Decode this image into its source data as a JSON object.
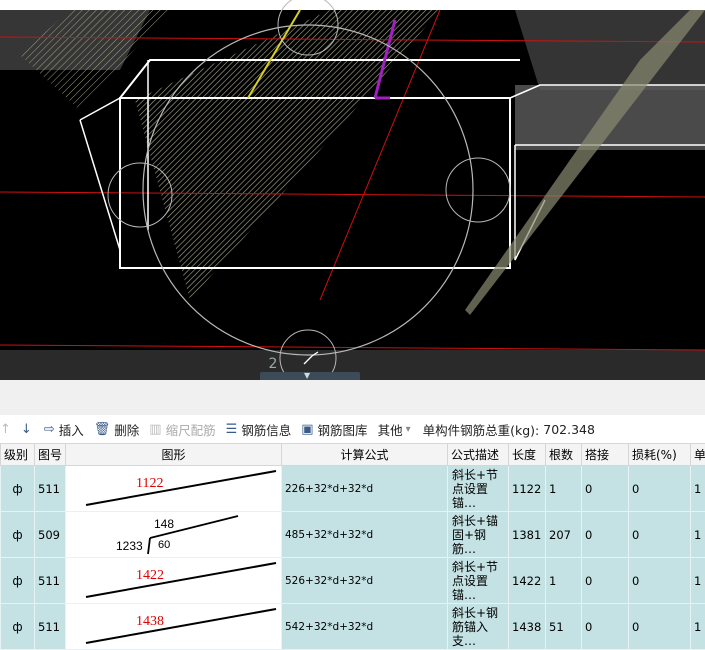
{
  "viewport": {
    "badge": "2",
    "tab_glyph": "▼"
  },
  "toolbar": {
    "first_icon": "↑",
    "down_icon": "↓",
    "insert": "插入",
    "delete": "删除",
    "scale": "缩尺配筋",
    "rebar_info": "钢筋信息",
    "rebar_library": "钢筋图库",
    "other": "其他",
    "other_caret": "▾",
    "total_label": "单构件钢筋总重(kg):",
    "total_value": "702.348"
  },
  "table": {
    "headers": [
      "级别",
      "图号",
      "图形",
      "计算公式",
      "公式描述",
      "长度",
      "根数",
      "搭接",
      "损耗(%)",
      "单"
    ],
    "rows": [
      {
        "grade": "ф",
        "code": "511",
        "shape_label": "1122",
        "formula": "226+32*d+32*d",
        "desc": "斜长+节点设置锚…",
        "length": "1122",
        "count": "1",
        "lap": "0",
        "loss": "0",
        "extra": "1"
      },
      {
        "grade": "ф",
        "code": "509",
        "shape_top": "148",
        "shape_left": "1233",
        "shape_angle": "60",
        "formula": "485+32*d+32*d",
        "desc": "斜长+锚固+钢筋…",
        "length": "1381",
        "count": "207",
        "lap": "0",
        "loss": "0",
        "extra": "1"
      },
      {
        "grade": "ф",
        "code": "511",
        "shape_label": "1422",
        "formula": "526+32*d+32*d",
        "desc": "斜长+节点设置锚…",
        "length": "1422",
        "count": "1",
        "lap": "0",
        "loss": "0",
        "extra": "1"
      },
      {
        "grade": "ф",
        "code": "511",
        "shape_label": "1438",
        "formula": "542+32*d+32*d",
        "desc": "斜长+钢筋锚入支…",
        "length": "1438",
        "count": "51",
        "lap": "0",
        "loss": "0",
        "extra": "1"
      }
    ]
  }
}
